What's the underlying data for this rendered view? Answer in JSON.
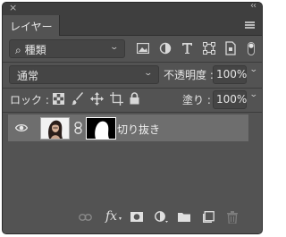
{
  "window": {
    "close_glyph": "×",
    "collapse_glyph": "‹‹"
  },
  "panel": {
    "tab_label": "レイヤー",
    "menu_icon": "panel-menu-icon"
  },
  "filter": {
    "search_glyph": "⌕",
    "kind_label": "種類",
    "filter_icons": [
      "pixel-filter-icon",
      "adjustment-filter-icon",
      "type-filter-icon",
      "shape-filter-icon",
      "smart-object-filter-icon"
    ]
  },
  "blend": {
    "mode": "通常",
    "opacity_label": "不透明度 :",
    "opacity_value": "100%"
  },
  "lock": {
    "label": "ロック :",
    "lock_icons": [
      "lock-transparent-icon",
      "lock-image-icon",
      "lock-position-icon",
      "lock-artboard-icon",
      "lock-all-icon"
    ],
    "fill_label": "塗り :",
    "fill_value": "100%"
  },
  "layers": [
    {
      "name": "切り抜き",
      "visible": true,
      "has_mask": true,
      "linked": true
    }
  ],
  "footer": {
    "fx_label": "fx",
    "icons": [
      "link-layers-icon",
      "fx-icon",
      "add-mask-icon",
      "adjustment-layer-icon",
      "new-group-icon",
      "new-layer-icon",
      "delete-layer-icon"
    ]
  },
  "colors": {
    "panel_bg": "#535353",
    "titlebar_bg": "#3f3f3f",
    "field_bg": "#454545",
    "selected_layer_bg": "#6e6e6e",
    "text": "#e6e6e6"
  }
}
